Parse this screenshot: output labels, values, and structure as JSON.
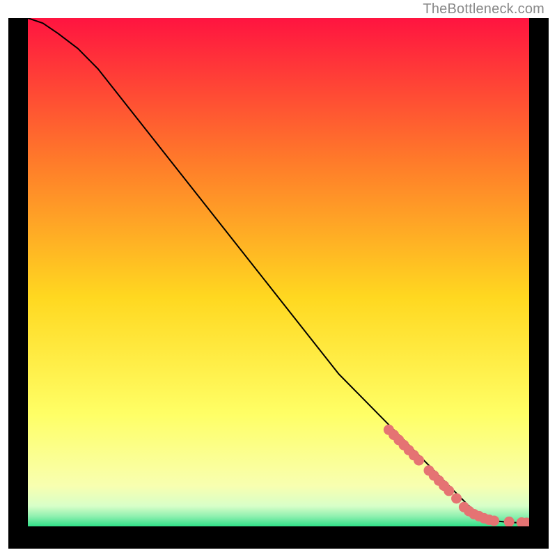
{
  "watermark": "TheBottleneck.com",
  "colors": {
    "frame": "#000000",
    "line": "#000000",
    "marker_fill": "#e57373",
    "marker_stroke": "#d05a5a",
    "gradient_top": "#ff1440",
    "gradient_mid_upper": "#ff7a2a",
    "gradient_mid": "#ffd820",
    "gradient_mid_lower": "#ffff66",
    "gradient_near_bottom": "#f8ffb0",
    "gradient_thin1": "#d8ffc8",
    "gradient_thin2": "#90f0b0",
    "gradient_bottom": "#30e088"
  },
  "chart_data": {
    "type": "line",
    "title": "",
    "xlabel": "",
    "ylabel": "",
    "xlim": [
      0,
      100
    ],
    "ylim": [
      0,
      100
    ],
    "grid": false,
    "legend": false,
    "series": [
      {
        "name": "curve",
        "x": [
          0,
          3,
          6,
          10,
          14,
          18,
          22,
          26,
          30,
          34,
          38,
          42,
          46,
          50,
          54,
          58,
          62,
          66,
          70,
          74,
          78,
          82,
          85,
          88,
          90,
          92,
          94,
          96,
          98,
          100
        ],
        "y": [
          100,
          99,
          97,
          94,
          90,
          85,
          80,
          75,
          70,
          65,
          60,
          55,
          50,
          45,
          40,
          35,
          30,
          26,
          22,
          18,
          14,
          10,
          7,
          4,
          2.5,
          1.5,
          1,
          0.8,
          0.7,
          0.6
        ]
      }
    ],
    "markers": {
      "name": "highlighted-points",
      "x": [
        72,
        73,
        74,
        75,
        76,
        77,
        78,
        80,
        81,
        82,
        83,
        84,
        85.5,
        87,
        88,
        89,
        90,
        91,
        92,
        93,
        96,
        98.5,
        99.5
      ],
      "y": [
        19,
        18,
        17,
        16,
        15,
        14,
        13,
        11,
        10,
        9,
        8,
        7,
        5.5,
        3.8,
        3,
        2.4,
        2,
        1.6,
        1.3,
        1.1,
        0.9,
        0.75,
        0.7
      ]
    }
  }
}
